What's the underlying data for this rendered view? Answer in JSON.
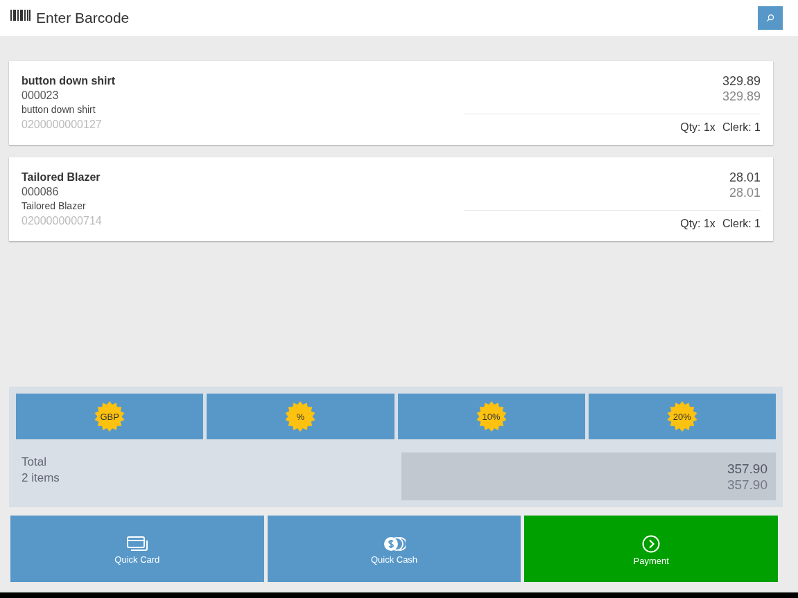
{
  "search": {
    "placeholder": "Enter Barcode"
  },
  "items": [
    {
      "name": "button down shirt",
      "code": "000023",
      "description": "button down shirt",
      "barcode": "0200000000127",
      "price": "329.89",
      "net_price": "329.89",
      "qty": "Qty: 1x",
      "clerk": "Clerk: 1"
    },
    {
      "name": "Tailored Blazer",
      "code": "000086",
      "description": "Tailored Blazer",
      "barcode": "0200000000714",
      "price": "28.01",
      "net_price": "28.01",
      "qty": "Qty: 1x",
      "clerk": "Clerk: 1"
    }
  ],
  "discounts": [
    "GBP",
    "%",
    "10%",
    "20%"
  ],
  "total": {
    "label": "Total",
    "count": "2 items",
    "amount": "357.90",
    "net_amount": "357.90"
  },
  "actions": [
    {
      "label": "Quick Card",
      "kind": "card"
    },
    {
      "label": "Quick Cash",
      "kind": "cash"
    },
    {
      "label": "Payment",
      "kind": "payment"
    }
  ]
}
